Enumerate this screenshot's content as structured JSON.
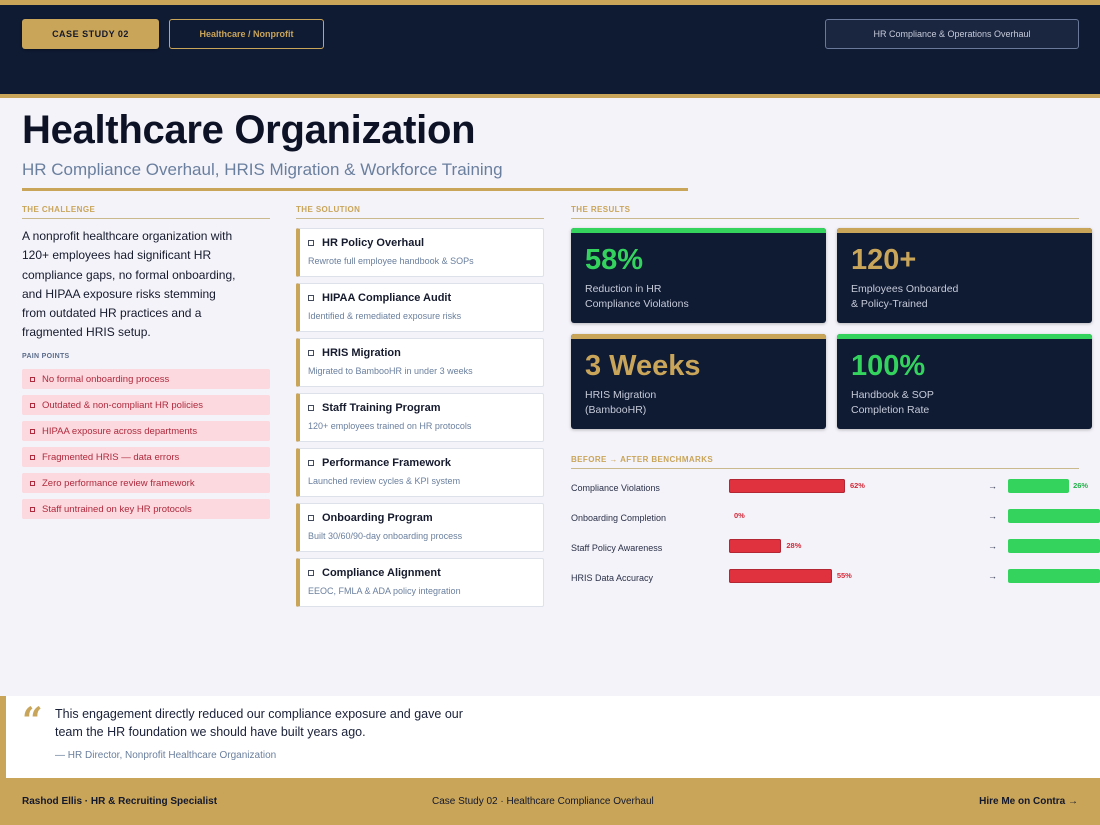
{
  "header": {
    "case_tag": "CASE STUDY  02",
    "sector_tag": "Healthcare / Nonprofit",
    "project_tag": "HR Compliance & Operations Overhaul"
  },
  "title": "Healthcare Organization",
  "subtitle": "HR Compliance Overhaul, HRIS Migration & Workforce Training",
  "challenge": {
    "label": "THE CHALLENGE",
    "text": "A nonprofit healthcare organization with 120+ employees had significant HR compliance gaps, no formal onboarding, and HIPAA exposure risks stemming from outdated HR practices and a fragmented HRIS setup.",
    "pain_label": "PAIN POINTS",
    "pain_points": [
      "No formal onboarding process",
      "Outdated & non-compliant HR policies",
      "HIPAA exposure across departments",
      "Fragmented HRIS — data errors",
      "Zero performance review framework",
      "Staff untrained on key HR protocols"
    ]
  },
  "solution": {
    "label": "THE SOLUTION",
    "items": [
      {
        "title": "HR Policy Overhaul",
        "desc": "Rewrote full employee handbook & SOPs"
      },
      {
        "title": "HIPAA Compliance Audit",
        "desc": "Identified & remediated exposure risks"
      },
      {
        "title": "HRIS Migration",
        "desc": "Migrated to BambooHR in under 3 weeks"
      },
      {
        "title": "Staff Training Program",
        "desc": "120+ employees trained on HR protocols"
      },
      {
        "title": "Performance Framework",
        "desc": "Launched review cycles & KPI system"
      },
      {
        "title": "Onboarding Program",
        "desc": "Built 30/60/90-day onboarding process"
      },
      {
        "title": "Compliance Alignment",
        "desc": "EEOC, FMLA & ADA policy integration"
      }
    ]
  },
  "results": {
    "label": "THE RESULTS",
    "cards": [
      {
        "value": "58%",
        "label1": "Reduction in HR",
        "label2": "Compliance Violations",
        "value_color": "#33d35e",
        "line_color": "#33d35e"
      },
      {
        "value": "120+",
        "label1": "Employees Onboarded",
        "label2": "& Policy-Trained",
        "value_color": "#c9a55a",
        "line_color": "#c9a55a"
      },
      {
        "value": "3 Weeks",
        "label1": "HRIS Migration",
        "label2": "(BambooHR)",
        "value_color": "#c9a55a",
        "line_color": "#c9a55a"
      },
      {
        "value": "100%",
        "label1": "Handbook & SOP",
        "label2": "Completion Rate",
        "value_color": "#33d35e",
        "line_color": "#33d35e"
      }
    ]
  },
  "benchmarks": {
    "label": "BEFORE  →  AFTER  BENCHMARKS",
    "rows": [
      {
        "name": "Compliance Violations",
        "before": 62,
        "before_label": "62%",
        "after": 26,
        "after_label": "26%"
      },
      {
        "name": "Onboarding Completion",
        "before": 0,
        "before_label": "0%",
        "after": 100,
        "after_label": ""
      },
      {
        "name": "Staff Policy Awareness",
        "before": 28,
        "before_label": "28%",
        "after": 100,
        "after_label": ""
      },
      {
        "name": "HRIS Data Accuracy",
        "before": 55,
        "before_label": "55%",
        "after": 100,
        "after_label": ""
      }
    ],
    "arrow": "→"
  },
  "quote": {
    "mark": "“",
    "text": "This engagement directly reduced our compliance exposure and gave our team the HR foundation we should have built years ago.",
    "author": "— HR Director, Nonprofit Healthcare Organization"
  },
  "footer": {
    "left": "Rashod Ellis  ·  HR & Recruiting Specialist",
    "center": "Case Study 02  ·  Healthcare Compliance Overhaul",
    "right": "Hire Me on Contra  →"
  },
  "colors": {
    "navy": "#0f1a33",
    "gold": "#c9a55a",
    "green": "#33d35e",
    "red": "#e0313f"
  }
}
